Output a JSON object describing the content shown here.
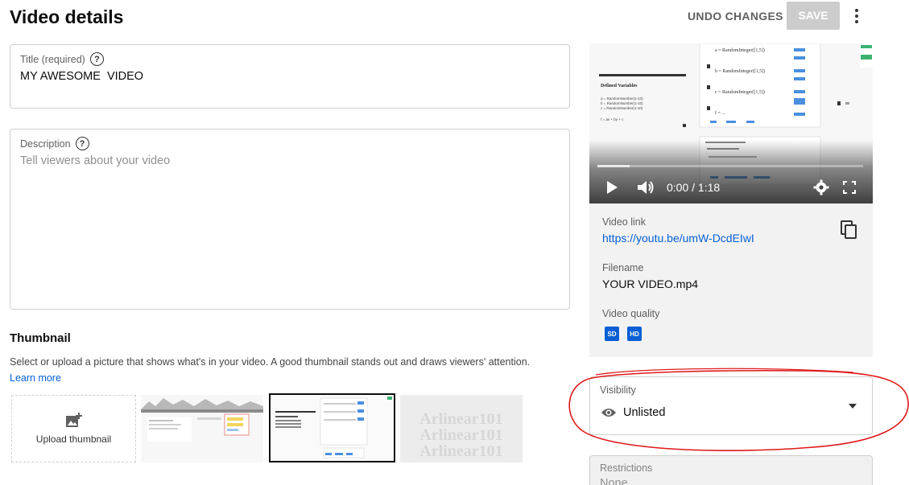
{
  "header": {
    "title": "Video details",
    "undo_label": "UNDO CHANGES",
    "save_label": "SAVE",
    "more_icon": "more-vert-icon"
  },
  "title_field": {
    "label": "Title (required)",
    "value": "MY AWESOME  VIDEO"
  },
  "description_field": {
    "label": "Description",
    "placeholder": "Tell viewers about your video"
  },
  "thumbnail": {
    "heading": "Thumbnail",
    "description": "Select or upload a picture that shows what's in your video. A good thumbnail stands out and draws viewers' attention.",
    "learn_more": "Learn more",
    "upload_label": "Upload thumbnail",
    "thumb4_text": "Arlinear101"
  },
  "player": {
    "time": "0:00 / 1:18",
    "progress": 0.12,
    "preview": {
      "defined_variables": "Defined Variables",
      "var_a": "a = RandomNumber(1-10)",
      "var_b": "b = RandomNumber(1-10)",
      "var_c": "c = RandomNumber(1-10)",
      "var_f": "f = ax + by + c",
      "row1": "a = RandomInteger([1,5])",
      "row2": "b = RandomInteger([1,5])",
      "row3": "c = RandomInteger([1,5])",
      "row4": "f = ..."
    }
  },
  "video_info": {
    "link_label": "Video link",
    "link_url": "https://youtu.be/umW-DcdEIwI",
    "filename_label": "Filename",
    "filename": "YOUR VIDEO.mp4",
    "quality_label": "Video quality",
    "quality_badges": [
      "SD",
      "HD"
    ]
  },
  "visibility": {
    "label": "Visibility",
    "value": "Unlisted"
  },
  "restrictions": {
    "label": "Restrictions",
    "value": "None"
  },
  "colors": {
    "accent": "#065fd4",
    "annotation": "#e0191a"
  }
}
